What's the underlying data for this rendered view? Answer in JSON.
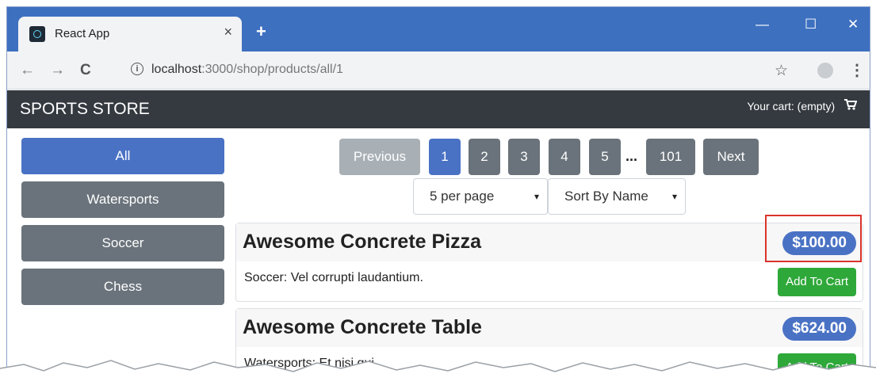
{
  "browser": {
    "tab_title": "React App",
    "tab_close": "×",
    "new_tab": "+",
    "window_controls": {
      "minimize": "—",
      "maximize": "☐",
      "close": "✕"
    },
    "url_host": "localhost",
    "url_path": ":3000/shop/products/all/1",
    "nav_icons": {
      "back": "←",
      "forward": "→",
      "reload": "C"
    },
    "star_icon": "☆",
    "menu_icon": "⋮"
  },
  "app": {
    "brand": "SPORTS STORE",
    "cart_text": "Your cart: (empty)",
    "cart_icon": "cart-icon"
  },
  "sidebar": {
    "categories": [
      {
        "label": "All",
        "active": true
      },
      {
        "label": "Watersports",
        "active": false
      },
      {
        "label": "Soccer",
        "active": false
      },
      {
        "label": "Chess",
        "active": false
      }
    ]
  },
  "pagination": {
    "previous": "Previous",
    "pages": [
      "1",
      "2",
      "3",
      "4",
      "5"
    ],
    "ellipsis": "...",
    "last": "101",
    "next": "Next",
    "current": "1"
  },
  "controls": {
    "page_size": "5 per page",
    "sort": "Sort By Name",
    "caret": "▾"
  },
  "products": [
    {
      "name": "Awesome Concrete Pizza",
      "price": "$100.00",
      "description": "Soccer: Vel corrupti laudantium.",
      "button": "Add To Cart"
    },
    {
      "name": "Awesome Concrete Table",
      "price": "$624.00",
      "description": "Watersports: Et nisi qui.",
      "button": "Add To Cart"
    }
  ],
  "colors": {
    "titlebar": "#3e70c0",
    "navbar": "#343a40",
    "primary": "#4a72c4",
    "secondary": "#6a737b",
    "success": "#2fa83a",
    "highlight": "#d9342b"
  }
}
